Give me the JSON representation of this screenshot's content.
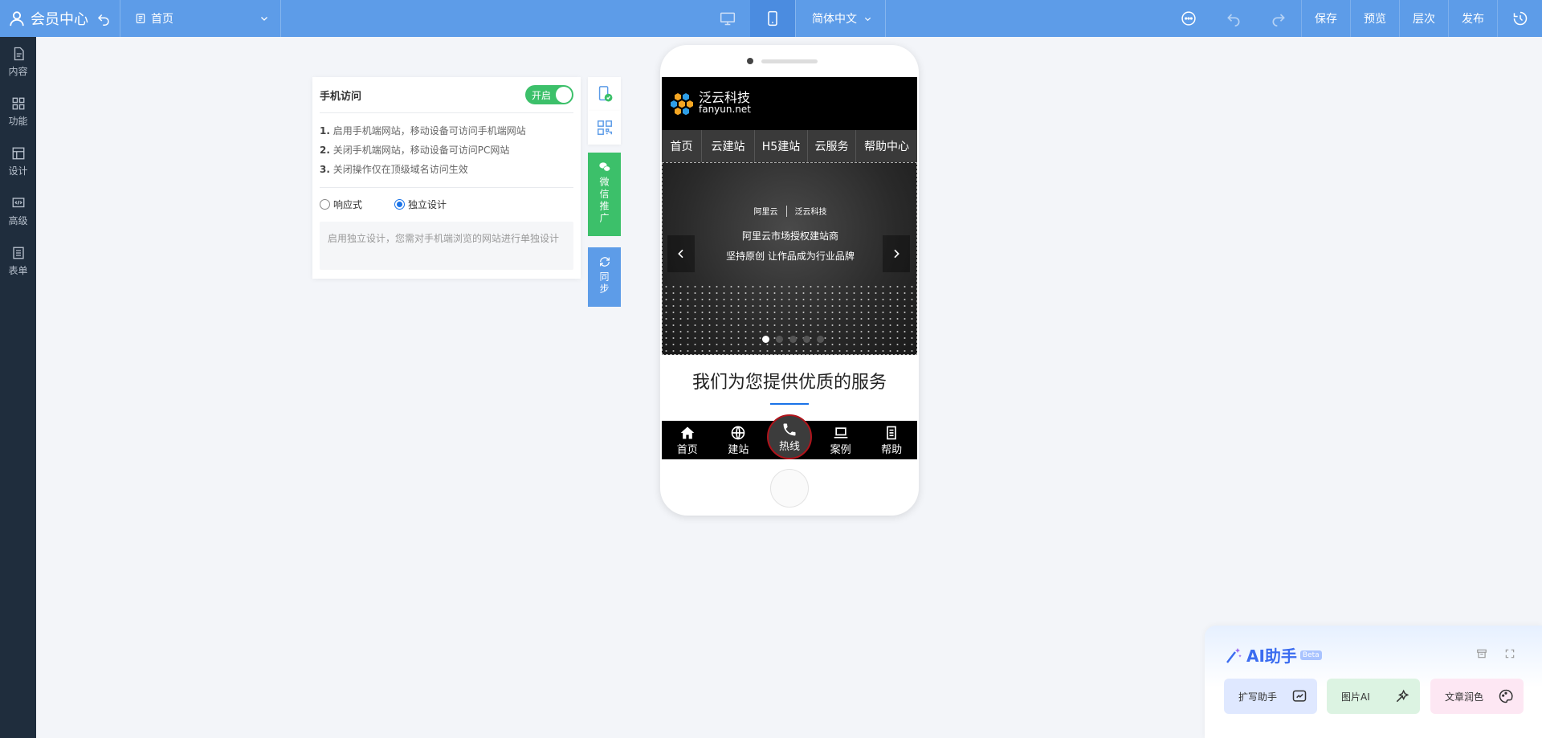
{
  "topbar": {
    "app_title": "会员中心",
    "page_selector": "首页",
    "language": "简体中文",
    "save": "保存",
    "preview": "预览",
    "layers": "层次",
    "publish": "发布"
  },
  "sidebar": {
    "items": [
      {
        "label": "内容",
        "icon": "document-icon"
      },
      {
        "label": "功能",
        "icon": "grid-icon"
      },
      {
        "label": "设计",
        "icon": "layout-icon"
      },
      {
        "label": "高级",
        "icon": "code-icon"
      },
      {
        "label": "表单",
        "icon": "form-icon"
      }
    ]
  },
  "panel": {
    "title": "手机访问",
    "toggle_label": "开启",
    "toggle_on": true,
    "notes": [
      {
        "num": "1.",
        "text": "启用手机端网站，移动设备可访问手机端网站"
      },
      {
        "num": "2.",
        "text": "关闭手机端网站，移动设备可访问PC网站"
      },
      {
        "num": "3.",
        "text": "关闭操作仅在顶级域名访问生效"
      }
    ],
    "radio_responsive": "响应式",
    "radio_independent": "独立设计",
    "selected": "独立设计",
    "hint": "启用独立设计，您需对手机端浏览的网站进行单独设计"
  },
  "tools": {
    "wechat": "微信推广",
    "sync": "同步"
  },
  "phone": {
    "logo_cn": "泛云科技",
    "logo_en": "fanyun.net",
    "nav": [
      "首页",
      "云建站",
      "H5建站",
      "云服务",
      "帮助中心"
    ],
    "banner_brand_a": "阿里云",
    "banner_brand_b": "泛云科技",
    "banner_line1": "阿里云市场授权建站商",
    "banner_line2": "坚持原创 让作品成为行业品牌",
    "services_heading": "我们为您提供优质的服务",
    "bottom_nav": [
      "首页",
      "建站",
      "热线",
      "案例",
      "帮助"
    ]
  },
  "ai": {
    "title": "AI助手",
    "badge": "Beta",
    "buttons": [
      "扩写助手",
      "图片AI",
      "文章润色"
    ]
  },
  "colors": {
    "topbar": "#5d9ce8",
    "sidebar": "#1f2d3d",
    "toggle": "#3cc06a",
    "accent": "#1a73e8"
  }
}
